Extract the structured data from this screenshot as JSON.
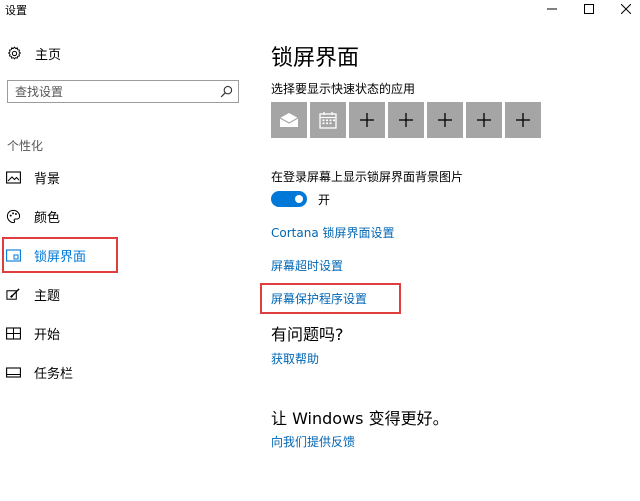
{
  "window": {
    "title": "设置",
    "minimize_icon": "minimize-icon",
    "maximize_icon": "maximize-icon",
    "close_icon": "close-icon"
  },
  "sidebar": {
    "home": {
      "label": "主页",
      "icon": "gear-icon"
    },
    "search": {
      "placeholder": "查找设置",
      "icon": "search-icon"
    },
    "section": "个性化",
    "items": [
      {
        "label": "背景",
        "icon": "picture-icon",
        "selected": false
      },
      {
        "label": "颜色",
        "icon": "palette-icon",
        "selected": false
      },
      {
        "label": "锁屏界面",
        "icon": "lock-screen-icon",
        "selected": true
      },
      {
        "label": "主题",
        "icon": "brush-icon",
        "selected": false
      },
      {
        "label": "开始",
        "icon": "start-grid-icon",
        "selected": false
      },
      {
        "label": "任务栏",
        "icon": "taskbar-icon",
        "selected": false
      }
    ]
  },
  "main": {
    "title": "锁屏界面",
    "quick_status_label": "选择要显示快速状态的应用",
    "quick_tiles": [
      {
        "icon": "mail-icon"
      },
      {
        "icon": "calendar-icon"
      },
      {
        "icon": "plus-icon"
      },
      {
        "icon": "plus-icon"
      },
      {
        "icon": "plus-icon"
      },
      {
        "icon": "plus-icon"
      },
      {
        "icon": "plus-icon"
      }
    ],
    "show_bg_label": "在登录屏幕上显示锁屏界面背景图片",
    "toggle_on": true,
    "toggle_state": "开",
    "link_cortana": "Cortana 锁屏界面设置",
    "link_timeout": "屏幕超时设置",
    "link_screensaver": "屏幕保护程序设置",
    "question_title": "有问题吗?",
    "link_help": "获取帮助",
    "improve_title": "让 Windows 变得更好。",
    "link_feedback": "向我们提供反馈"
  },
  "colors": {
    "accent": "#0078d7",
    "link": "#0066b4",
    "highlight": "#e03e3e",
    "tile": "#a5a5a5"
  }
}
